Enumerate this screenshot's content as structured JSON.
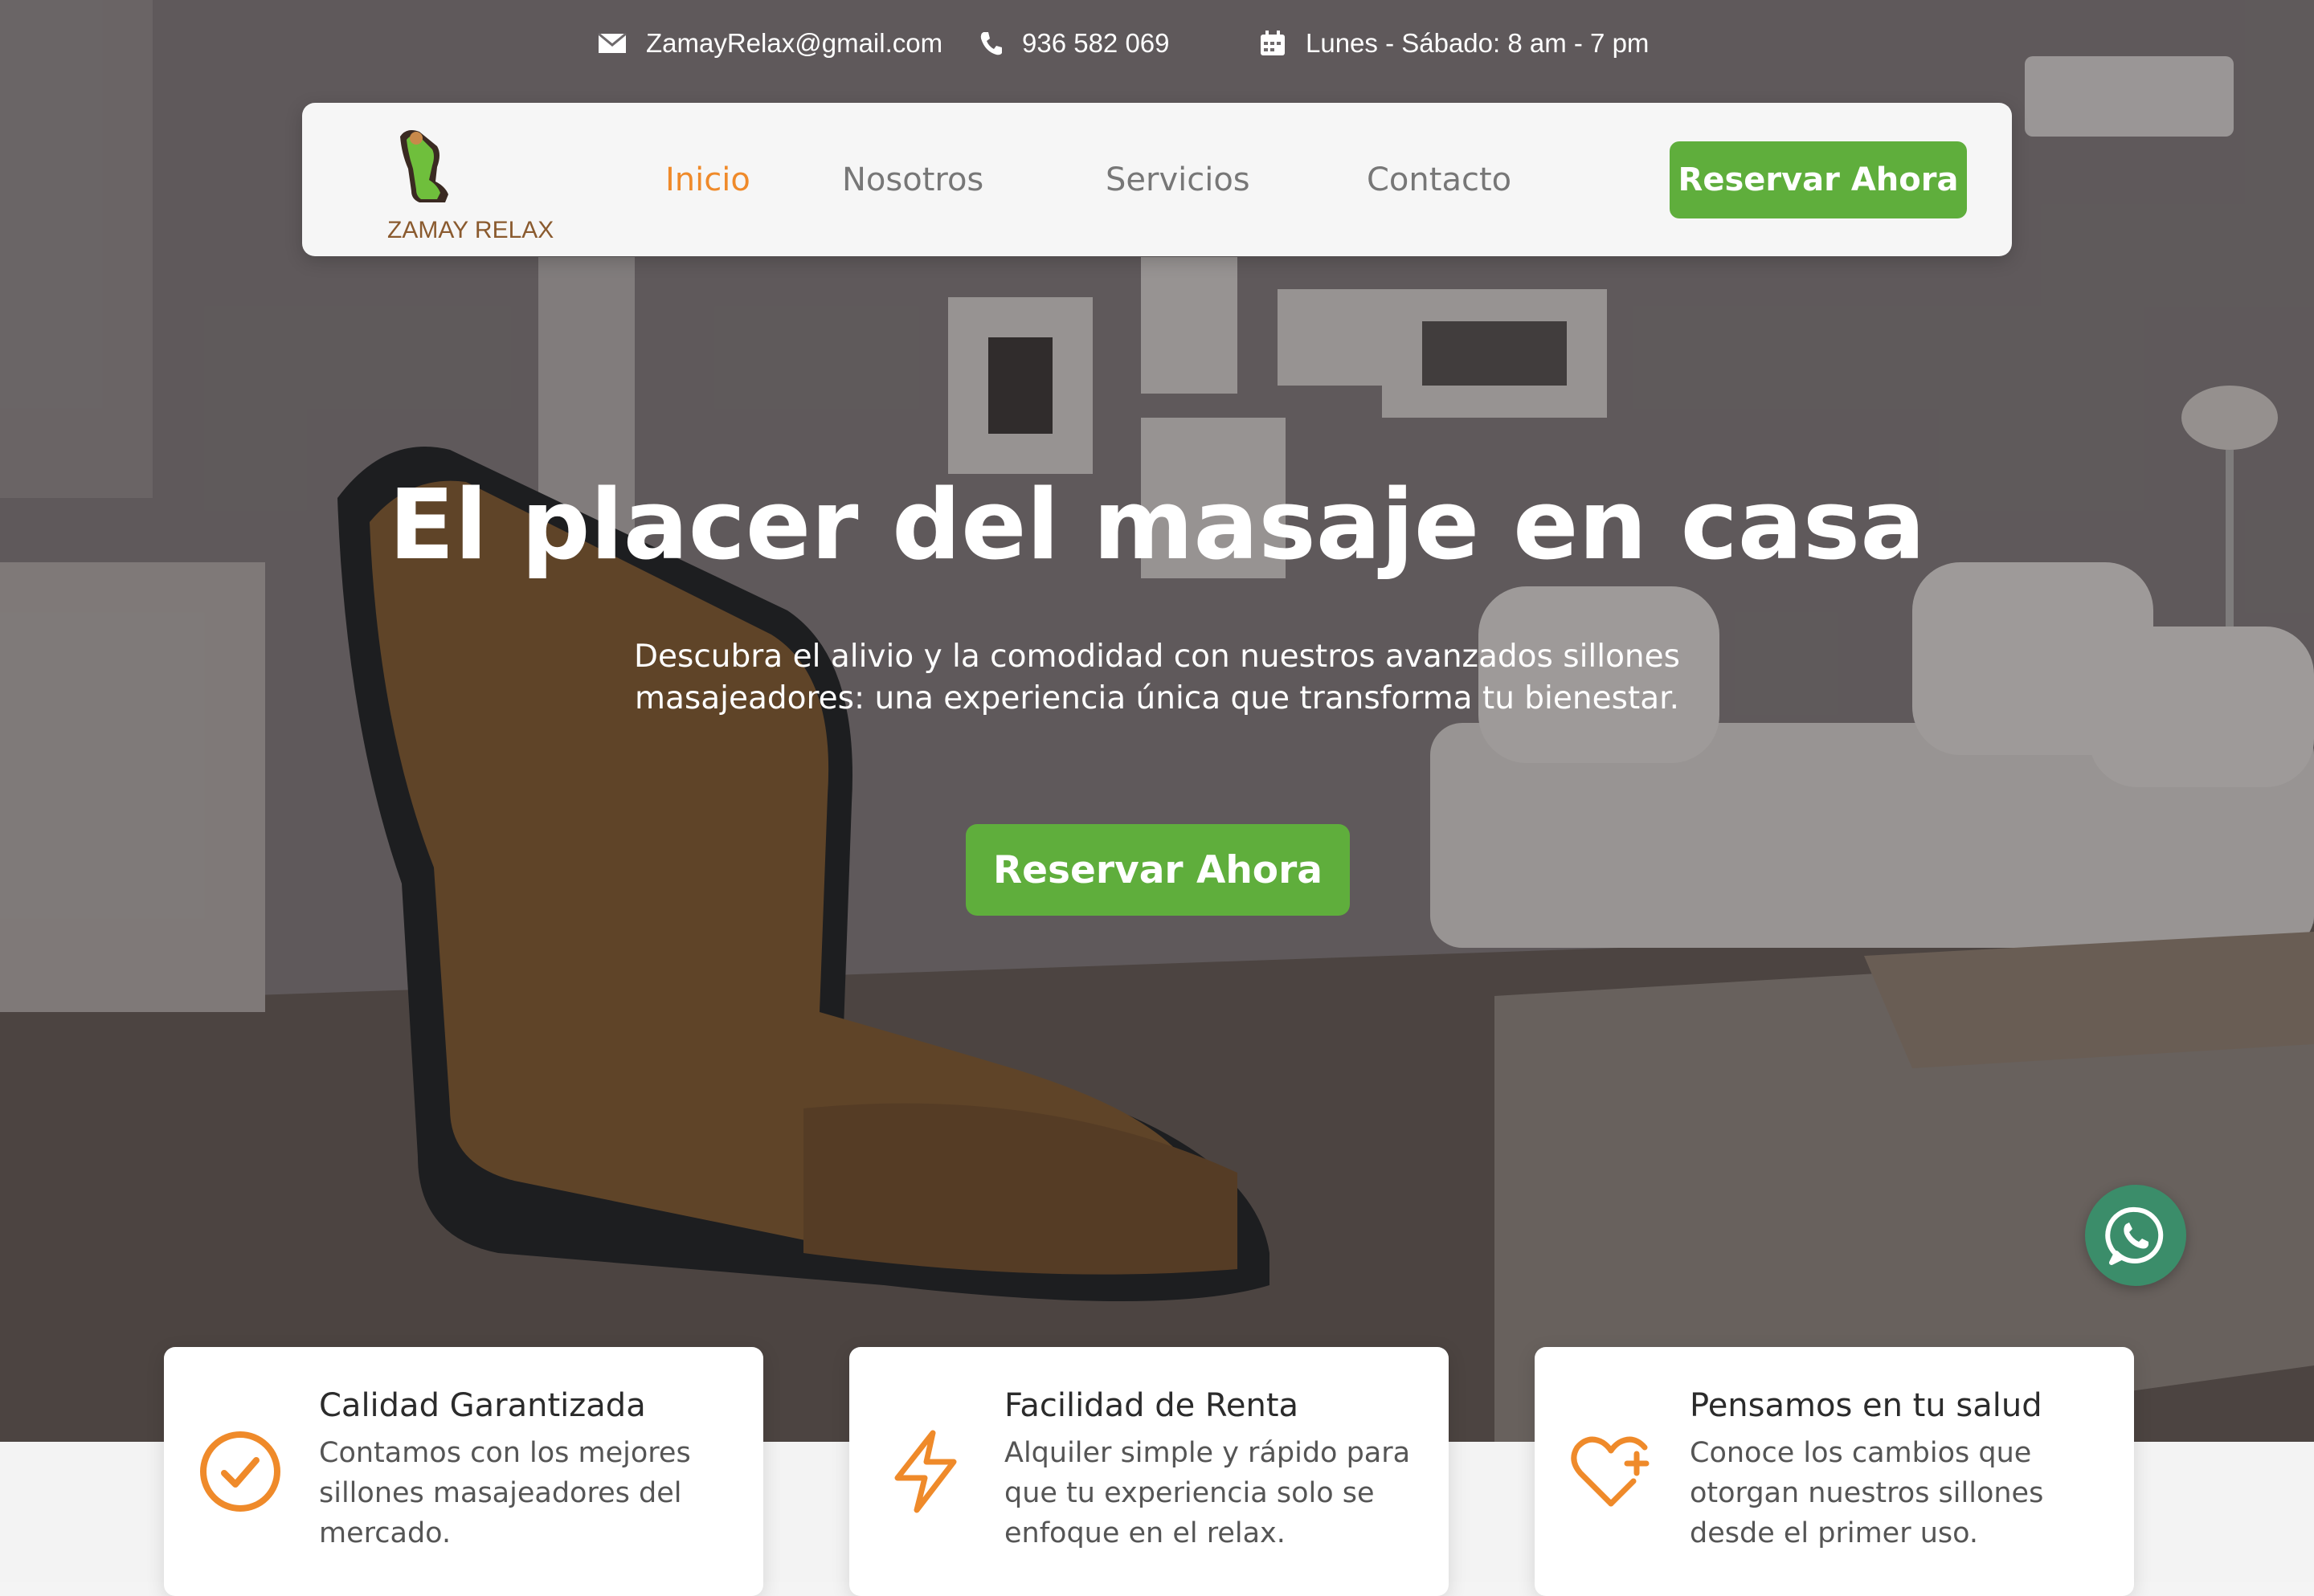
{
  "topbar": {
    "email": "ZamayRelax@gmail.com",
    "phone": "936 582 069",
    "hours": "Lunes - Sábado: 8 am - 7 pm",
    "email_icon": "envelope-icon",
    "phone_icon": "phone-icon",
    "hours_icon": "calendar-icon"
  },
  "brand": {
    "logo_text": "ZAMAY RELAX",
    "logo_icon": "massage-chair-logo"
  },
  "nav": {
    "items": [
      {
        "label": "Inicio",
        "active": true
      },
      {
        "label": "Nosotros",
        "active": false
      },
      {
        "label": "Servicios",
        "active": false
      },
      {
        "label": "Contacto",
        "active": false
      }
    ],
    "cta_label": "Reservar Ahora"
  },
  "hero": {
    "title": "El placer del masaje en casa",
    "subtitle": "Descubra el alivio y la comodidad con nuestros avanzados sillones masajeadores: una experiencia única que transforma tu bienestar.",
    "cta_label": "Reservar Ahora"
  },
  "whatsapp": {
    "icon": "whatsapp-icon"
  },
  "features": [
    {
      "title": "Calidad Garantizada",
      "text": "Contamos con los mejores sillones masajeadores del mercado.",
      "icon": "check-circle-icon"
    },
    {
      "title": "Facilidad de Renta",
      "text": "Alquiler simple y rápido para que tu experiencia solo se enfoque en el relax.",
      "icon": "lightning-icon"
    },
    {
      "title": "Pensamos en tu salud",
      "text": "Conoce los cambios que otorgan nuestros sillones desde el primer uso.",
      "icon": "heart-plus-icon"
    }
  ],
  "colors": {
    "accent_green": "#5fae3c",
    "accent_orange": "#ef8a2a",
    "whatsapp_green": "#3b8d6a"
  }
}
